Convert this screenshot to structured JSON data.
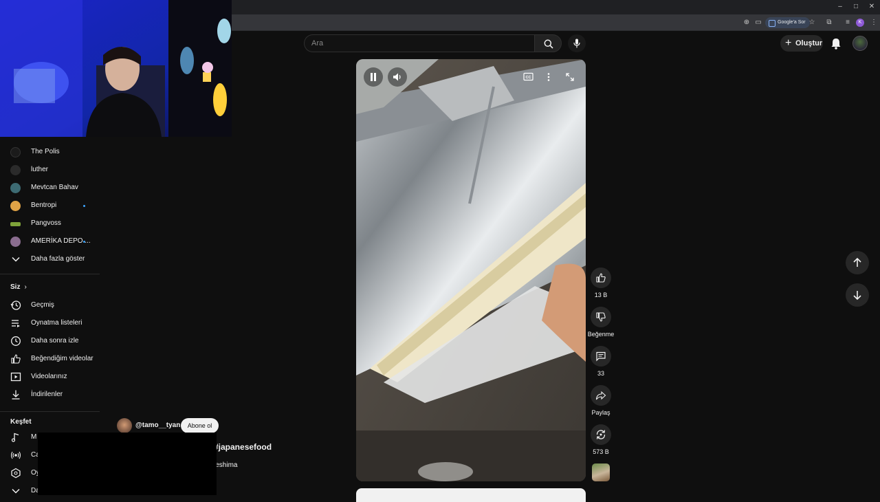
{
  "browser": {
    "google_sor": "Google'a Sor",
    "profile_initial": "K",
    "window_controls": [
      "–",
      "□",
      "✕"
    ]
  },
  "search": {
    "placeholder": "Ara"
  },
  "header": {
    "create_label": "Oluştur"
  },
  "sidebar": {
    "subscriptions": [
      {
        "name": "The Polis",
        "new": false,
        "avatar_color": "#1b1b1b"
      },
      {
        "name": "luther",
        "new": false,
        "avatar_color": "#2b2b2b"
      },
      {
        "name": "Mevtcan Bahav",
        "new": false,
        "avatar_color": "#3d6b73"
      },
      {
        "name": "Bentropi",
        "new": true,
        "avatar_color": "#e0a346"
      },
      {
        "name": "Pangvoss",
        "new": false,
        "avatar_color": "#7fa33a"
      },
      {
        "name": "AMERİKA DEPO ...",
        "new": true,
        "avatar_color": "#8a6d8f"
      }
    ],
    "show_more": "Daha fazla göster",
    "you_heading": "Siz",
    "you_items": [
      {
        "label": "Geçmiş",
        "icon": "history-icon"
      },
      {
        "label": "Oynatma listeleri",
        "icon": "playlists-icon"
      },
      {
        "label": "Daha sonra izle",
        "icon": "watch-later-icon"
      },
      {
        "label": "Beğendiğim videolar",
        "icon": "liked-icon"
      },
      {
        "label": "Videolarınız",
        "icon": "your-videos-icon"
      },
      {
        "label": "İndirilenler",
        "icon": "downloads-icon"
      }
    ],
    "explore_heading": "Keşfet",
    "explore_items": [
      {
        "label": "M",
        "icon": "music-icon"
      },
      {
        "label": "Ca",
        "icon": "live-icon"
      },
      {
        "label": "Oy",
        "icon": "gaming-icon"
      },
      {
        "label": "Da",
        "icon": "chevron-down-icon"
      }
    ]
  },
  "short": {
    "channel": "@tamo__tyan",
    "subscribe_label": "Abone ol",
    "title_fragment": "#japanesefood",
    "subtitle_fragment": "ieshima"
  },
  "actions": {
    "likes": "13 B",
    "dislike_label": "Beğenme",
    "comments": "33",
    "share_label": "Paylaş",
    "remix_count": "573 B"
  },
  "colors": {
    "accent": "#3ea6ff",
    "background": "#0f0f0f",
    "button_bg": "#272727"
  }
}
